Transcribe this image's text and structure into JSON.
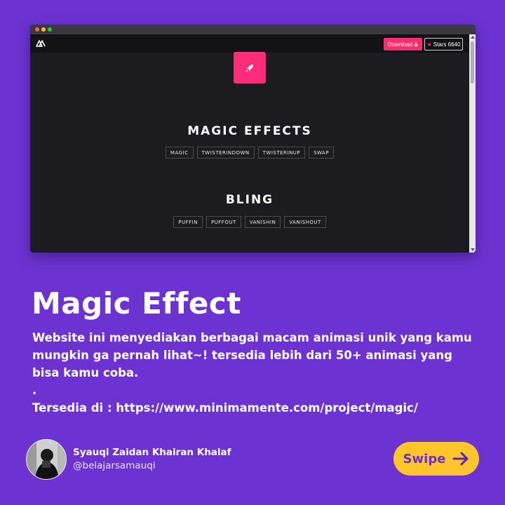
{
  "browser": {
    "nav": {
      "download_label": "Download",
      "stars_label": "Stars 6640"
    },
    "sections": [
      {
        "title": "MAGIC EFFECTS",
        "tags": [
          "MAGIC",
          "TWISTERINDOWN",
          "TWISTERINUP",
          "SWAP"
        ]
      },
      {
        "title": "BLING",
        "tags": [
          "PUFFIN",
          "PUFFOUT",
          "VANISHIN",
          "VANISHOUT"
        ]
      }
    ]
  },
  "post": {
    "title": "Magic Effect",
    "description": "Website ini menyediakan berbagai macam animasi unik yang kamu mungkin ga pernah lihat~! tersedia lebih dari 50+ animasi yang bisa kamu coba.",
    "separator": ".",
    "available_at": "Tersedia di : https://www.minimamente.com/project/magic/"
  },
  "author": {
    "name": "Syauqi Zaidan Khairan Khalaf",
    "handle": "@belajarsamauqi"
  },
  "swipe": {
    "label": "Swipe"
  },
  "colors": {
    "background": "#6c32d2",
    "accent_pink": "#ff2d6e",
    "swipe_yellow": "#ffc62c"
  },
  "icons": {
    "site_logo": "triangle-logo-icon",
    "rocket": "rocket-icon",
    "download": "arrow-down-icon",
    "star": "star-icon",
    "swipe": "arrow-right-icon"
  }
}
